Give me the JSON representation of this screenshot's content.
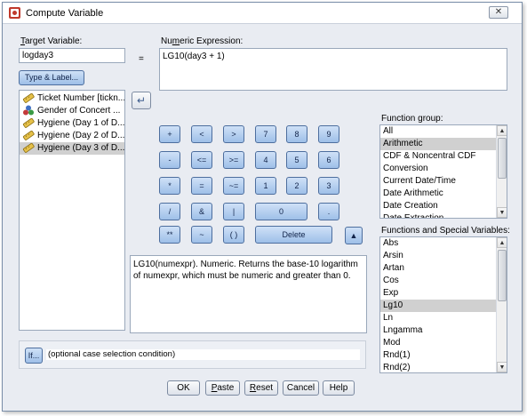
{
  "window": {
    "title": "Compute Variable",
    "close_glyph": "✕"
  },
  "target": {
    "label": "Target Variable:",
    "value": "logday3",
    "type_label_button": "Type & Label..."
  },
  "expression": {
    "label": "Numeric Expression:",
    "equals": "=",
    "value": "LG10(day3 + 1)"
  },
  "variables": [
    {
      "icon": "ruler-icon",
      "label": "Ticket Number [tickn...",
      "selected": false
    },
    {
      "icon": "nominal-circles-icon",
      "label": "Gender of Concert ...",
      "selected": false
    },
    {
      "icon": "ruler-icon",
      "label": "Hygiene (Day 1 of D...",
      "selected": false
    },
    {
      "icon": "ruler-icon",
      "label": "Hygiene (Day 2 of D...",
      "selected": false
    },
    {
      "icon": "ruler-icon",
      "label": "Hygiene (Day 3 of D...",
      "selected": true
    }
  ],
  "transfer_arrow": "↵",
  "keypad": {
    "rows": [
      [
        "+",
        "<",
        ">",
        "7",
        "8",
        "9"
      ],
      [
        "-",
        "<=",
        ">=",
        "4",
        "5",
        "6"
      ],
      [
        "*",
        "=",
        "~=",
        "1",
        "2",
        "3"
      ],
      [
        "/",
        "&",
        "|",
        "0",
        "."
      ],
      [
        "**",
        "~",
        "( )",
        "Delete"
      ]
    ]
  },
  "description": "LG10(numexpr). Numeric. Returns the base-10 logarithm of numexpr, which must be numeric and greater than 0.",
  "up_arrow": "▲",
  "function_group": {
    "label": "Function group:",
    "items": [
      "All",
      "Arithmetic",
      "CDF & Noncentral CDF",
      "Conversion",
      "Current Date/Time",
      "Date Arithmetic",
      "Date Creation",
      "Date Extraction"
    ],
    "selected": "Arithmetic"
  },
  "functions": {
    "label": "Functions and Special Variables:",
    "items": [
      "Abs",
      "Arsin",
      "Artan",
      "Cos",
      "Exp",
      "Lg10",
      "Ln",
      "Lngamma",
      "Mod",
      "Rnd(1)",
      "Rnd(2)"
    ],
    "selected": "Lg10"
  },
  "if_section": {
    "button": "If...",
    "text": "(optional case selection condition)"
  },
  "footer": {
    "ok": "OK",
    "paste": "Paste",
    "reset": "Reset",
    "cancel": "Cancel",
    "help": "Help"
  }
}
